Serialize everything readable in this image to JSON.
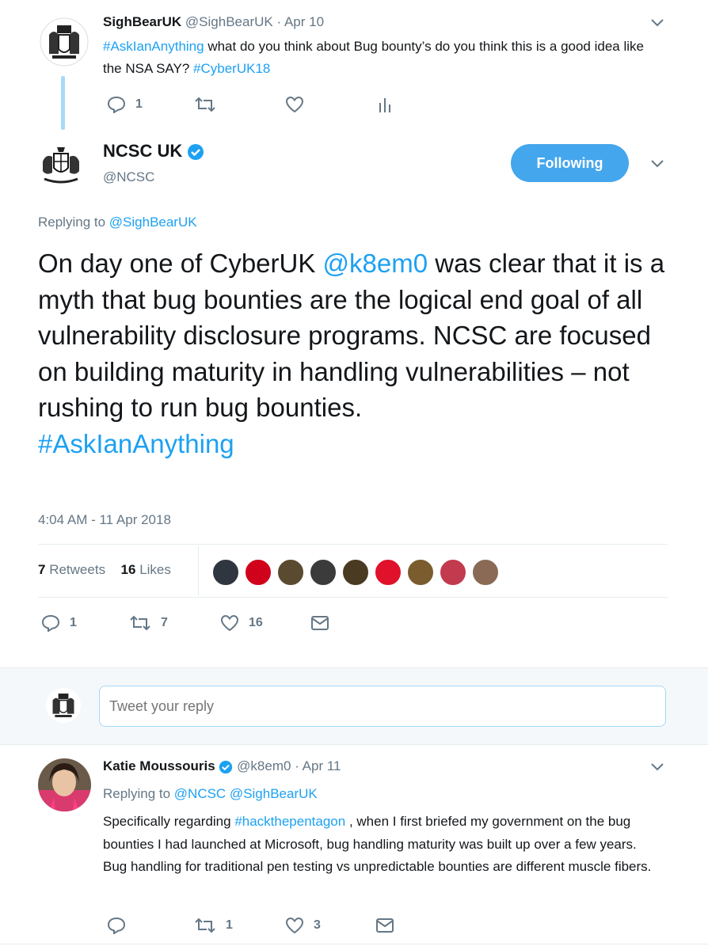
{
  "parent_tweet": {
    "name": "SighBearUK",
    "handle": "@SighBearUK",
    "sep": "·",
    "date": "Apr 10",
    "text_hashtag1": "#AskIanAnything",
    "text_body": " what do you think about Bug bounty’s do you think this is a good idea like the NSA SAY? ",
    "text_hashtag2": "#CyberUK18",
    "reply_count": "1"
  },
  "main_tweet": {
    "name": "NCSC UK",
    "handle": "@NCSC",
    "follow_label": "Following",
    "replying_prefix": "Replying to ",
    "replying_to": "@SighBearUK",
    "text_part1": "On day one of CyberUK ",
    "text_mention": "@k8em0",
    "text_part2": " was clear that it is a myth that bug bounties are the logical end goal of all vulnerability disclosure programs. NCSC are focused on building maturity in handling vulnerabilities – not rushing to run bug bounties.",
    "text_hashtag": "#AskIanAnything",
    "timestamp": "4:04 AM - 11 Apr 2018",
    "retweets_count": "7",
    "retweets_label": "Retweets",
    "likes_count": "16",
    "likes_label": "Likes",
    "liker_colors": [
      "#2f3640",
      "#d0021b",
      "#5a4a2f",
      "#3b3b3b",
      "#4a3a22",
      "#e0112b",
      "#7a5c2e",
      "#c23a4e",
      "#8a6a55"
    ],
    "reply_count": "1",
    "retweet_count": "7",
    "like_count": "16"
  },
  "reply_box": {
    "placeholder": "Tweet your reply"
  },
  "reply_tweet": {
    "name": "Katie Moussouris",
    "handle": "@k8em0",
    "sep": "·",
    "date": "Apr 11",
    "replying_prefix": "Replying to ",
    "replying_to": "@NCSC @SighBearUK",
    "text_part1": "Specifically regarding ",
    "text_hashtag": "#hackthepentagon",
    "text_part2": " , when I first briefed my government on the bug bounties I had launched at Microsoft, bug handling maturity was built up over a few years. Bug handling for traditional pen testing vs unpredictable bounties are different muscle fibers.",
    "retweet_count": "1",
    "like_count": "3"
  },
  "colors": {
    "accent": "#1da1f2",
    "follow_button": "#44a6ec",
    "muted": "#657786",
    "divider": "#e6ecf0",
    "composer_bg": "#f5f8fa"
  }
}
